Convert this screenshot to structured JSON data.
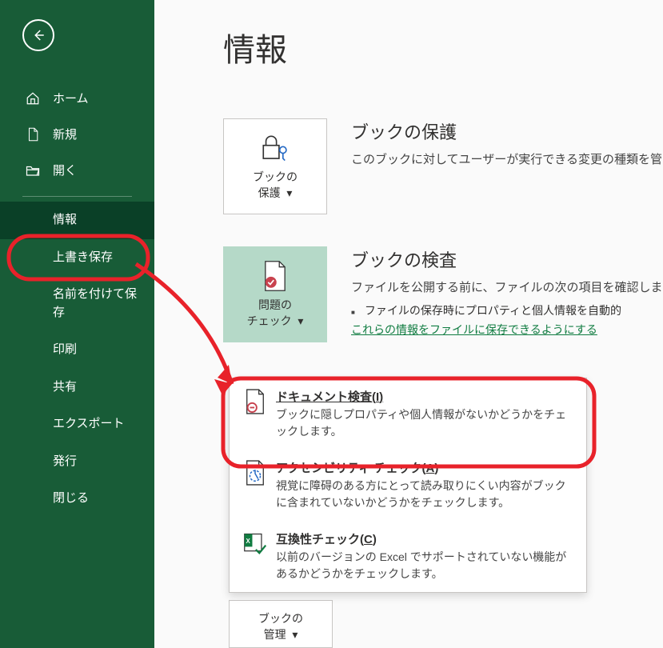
{
  "sidebar": {
    "home": "ホーム",
    "new": "新規",
    "open": "開く",
    "info": "情報",
    "save": "上書き保存",
    "save_as": "名前を付けて保存",
    "print": "印刷",
    "share": "共有",
    "export": "エクスポート",
    "publish": "発行",
    "close": "閉じる"
  },
  "page": {
    "title": "情報"
  },
  "protect": {
    "button_line1": "ブックの",
    "button_line2": "保護",
    "title": "ブックの保護",
    "desc": "このブックに対してユーザーが実行できる変更の種類を管"
  },
  "inspect": {
    "button_line1": "問題の",
    "button_line2": "チェック",
    "title": "ブックの検査",
    "desc": "ファイルを公開する前に、ファイルの次の項目を確認しま",
    "bullet": "ファイルの保存時にプロパティと個人情報を自動的",
    "link": "これらの情報をファイルに保存できるようにする"
  },
  "menu": {
    "inspect": {
      "title": "ドキュメント検査(I)",
      "desc": "ブックに隠しプロパティや個人情報がないかどうかをチェックします。"
    },
    "accessibility": {
      "title": "アクセシビリティ チェック(A)",
      "desc": "視覚に障碍のある方にとって読み取りにくい内容がブックに含まれていないかどうかをチェックします。"
    },
    "compatibility": {
      "title": "互換性チェック(C)",
      "desc": "以前のバージョンの Excel でサポートされていない機能があるかどうかをチェックします。"
    }
  },
  "manage": {
    "button_line1": "ブックの",
    "button_line2": "管理"
  }
}
